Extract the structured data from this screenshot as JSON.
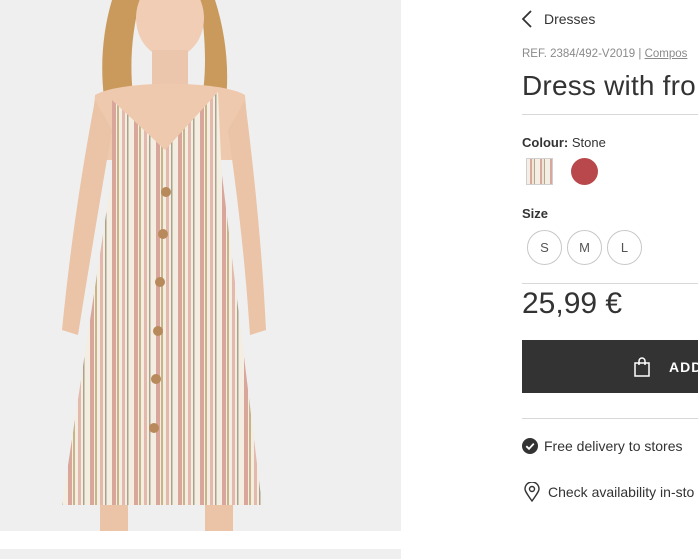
{
  "breadcrumb": {
    "back_label": "Dresses"
  },
  "product": {
    "reference": "REF. 2384/492-V2019 |",
    "composition_link": "Compos",
    "title": "Dress with fro",
    "colour_label": "Colour:",
    "colour_value": "Stone",
    "colours": [
      {
        "name": "stone-striped",
        "hex": "#efe6d6"
      },
      {
        "name": "red",
        "hex": "#b8484b"
      }
    ],
    "size_label": "Size",
    "sizes": [
      "S",
      "M",
      "L"
    ],
    "price": "25,99 €",
    "add_button_label": "ADD"
  },
  "services": {
    "delivery": "Free delivery to stores",
    "availability": "Check availability in-sto"
  },
  "colors": {
    "button_bg": "#333333",
    "accent_red": "#b8484b",
    "image_bg": "#efefef"
  }
}
